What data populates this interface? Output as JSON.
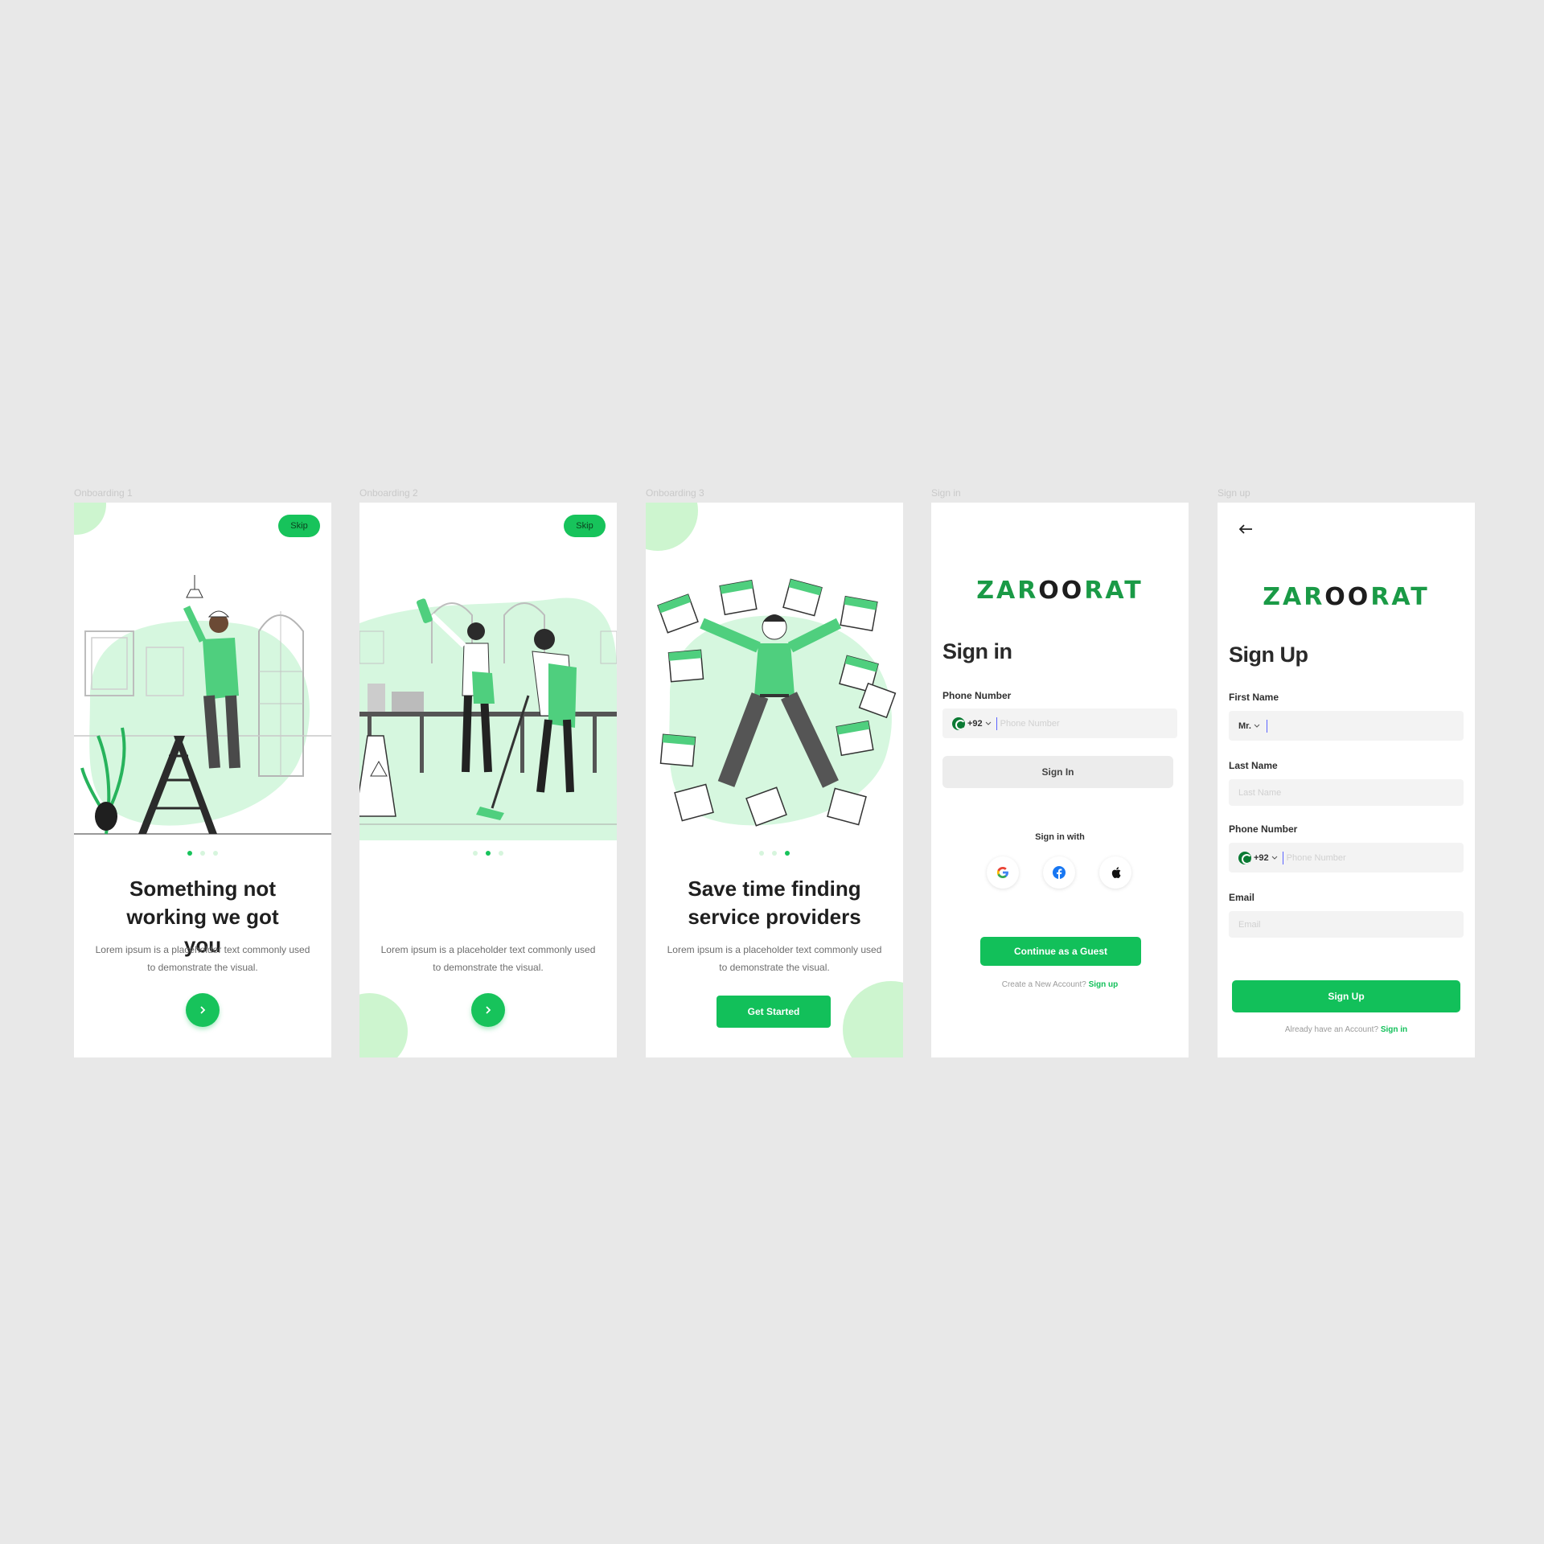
{
  "frames": [
    {
      "label": "Onboarding 1",
      "skip": "Skip",
      "title": "Something not working we got you",
      "body": "Lorem ipsum is a placeholder text commonly used to demonstrate the visual."
    },
    {
      "label": "Onboarding 2",
      "skip": "Skip",
      "body": "Lorem ipsum is a placeholder text commonly used to demonstrate the visual."
    },
    {
      "label": "Onboarding 3",
      "title": "Save time finding service providers",
      "body": "Lorem ipsum is a placeholder text commonly used to demonstrate the visual.",
      "cta": "Get Started"
    },
    {
      "label": "Sign in"
    },
    {
      "label": "Sign up"
    }
  ],
  "brand": {
    "logo_green_1": "ZAR",
    "logo_dark": "OO",
    "logo_green_2": "RAT"
  },
  "signin": {
    "title": "Sign in",
    "phone_label": "Phone Number",
    "country_code": "+92",
    "phone_placeholder": "Phone Number",
    "signin_button": "Sign In",
    "signin_with": "Sign in with",
    "guest_button": "Continue as a Guest",
    "footer_text": "Create a New Account?",
    "footer_link": "Sign up"
  },
  "signup": {
    "title": "Sign Up",
    "first_name_label": "First Name",
    "salutation": "Mr.",
    "last_name_label": "Last Name",
    "last_name_placeholder": "Last Name",
    "phone_label": "Phone Number",
    "country_code": "+92",
    "phone_placeholder": "Phone Number",
    "email_label": "Email",
    "email_placeholder": "Email",
    "signup_button": "Sign Up",
    "footer_text": "Already have an Account?",
    "footer_link": "Sign in"
  },
  "icons": {
    "next": "chevron-right-icon",
    "back": "arrow-left-icon",
    "google": "google-icon",
    "facebook": "facebook-icon",
    "apple": "apple-icon",
    "flag": "pakistan-flag-icon"
  },
  "colors": {
    "accent": "#17c35b",
    "blob": "#cdf5cf",
    "background": "#e8e8e8",
    "brand_green": "#1a9a46"
  }
}
